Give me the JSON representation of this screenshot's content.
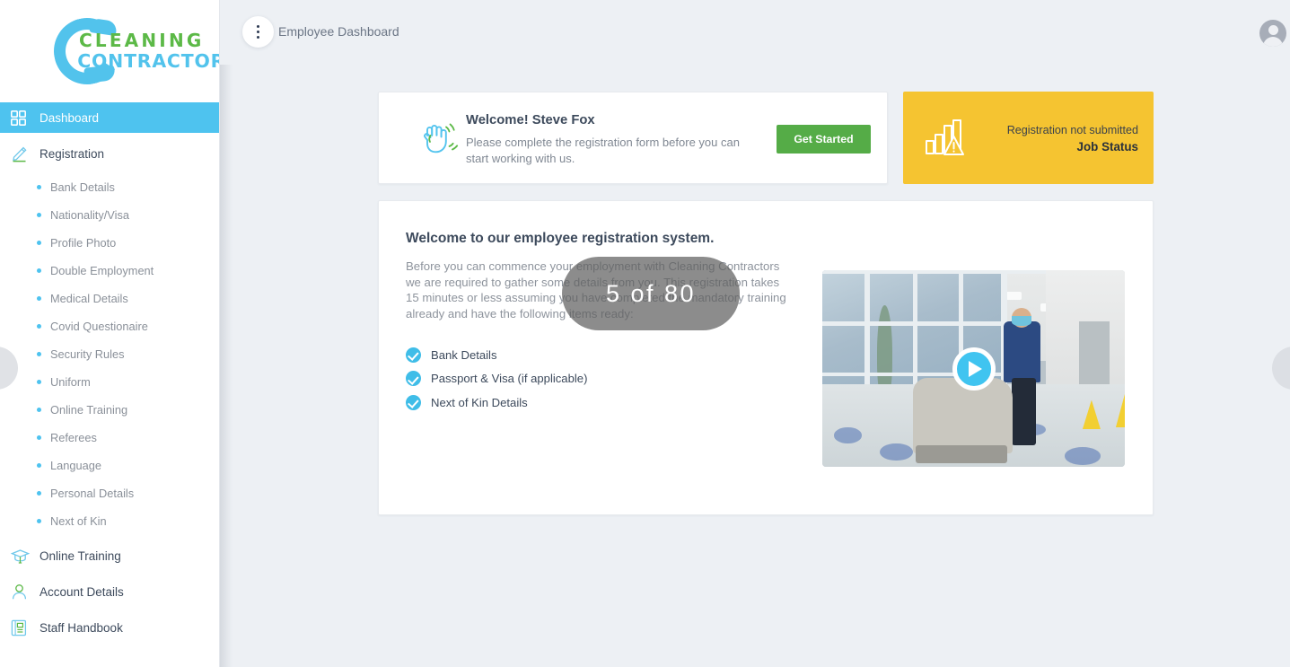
{
  "brand": {
    "line1": "CLEANING",
    "line2": "CONTRACTORS",
    "green": "#5cb947",
    "blue": "#52c3ec"
  },
  "topbar": {
    "page_title": "Employee Dashboard",
    "kebab_icon": "kebab-menu-icon",
    "avatar_icon": "user-avatar-icon"
  },
  "sidebar": {
    "items": [
      {
        "label": "Dashboard",
        "icon": "grid-dashboard-icon",
        "active": true
      },
      {
        "label": "Registration",
        "icon": "pencil-edit-icon",
        "active": false
      }
    ],
    "registration_sub_items": [
      {
        "label": "Bank Details"
      },
      {
        "label": "Nationality/Visa"
      },
      {
        "label": "Profile Photo"
      },
      {
        "label": "Double Employment"
      },
      {
        "label": "Medical Details"
      },
      {
        "label": "Covid Questionaire"
      },
      {
        "label": "Security Rules"
      },
      {
        "label": "Uniform"
      },
      {
        "label": "Online Training"
      },
      {
        "label": "Referees"
      },
      {
        "label": "Language"
      },
      {
        "label": "Personal Details"
      },
      {
        "label": "Next of Kin"
      }
    ],
    "bottom_items": [
      {
        "label": "Online Training",
        "icon": "graduation-cap-icon"
      },
      {
        "label": "Account Details",
        "icon": "user-account-icon"
      },
      {
        "label": "Staff Handbook",
        "icon": "book-handbook-icon"
      }
    ],
    "active_color": "#4ec3ef"
  },
  "welcome_card": {
    "icon": "waving-hand-icon",
    "title": "Welcome! Steve Fox",
    "subtitle": "Please complete the registration form before you can start working with us.",
    "button_label": "Get Started",
    "button_color": "#55ac47"
  },
  "status_card": {
    "icon": "bar-chart-warning-icon",
    "line1": "Registration not submitted",
    "line2": "Job Status",
    "background": "#f5c431"
  },
  "main_card": {
    "title": "Welcome to our employee registration system.",
    "paragraph": "Before you can commence your employment with Cleaning Contractors we are required to gather some details from you. This registration takes 15 minutes or less assuming you have completed the mandatory training already and have the following items ready:",
    "checklist": [
      {
        "label": "Bank Details",
        "icon": "check-circle-icon"
      },
      {
        "label": "Passport & Visa (if applicable)",
        "icon": "check-circle-icon"
      },
      {
        "label": "Next of Kin Details",
        "icon": "check-circle-icon"
      }
    ],
    "video": {
      "play_icon": "play-button-icon",
      "alt": "cleaning-operative-floor-scrubber-video-thumbnail"
    }
  },
  "overlay": {
    "text": "5 of 80"
  },
  "carousel": {
    "prev_icon": "carousel-prev-handle",
    "next_icon": "carousel-next-handle"
  }
}
